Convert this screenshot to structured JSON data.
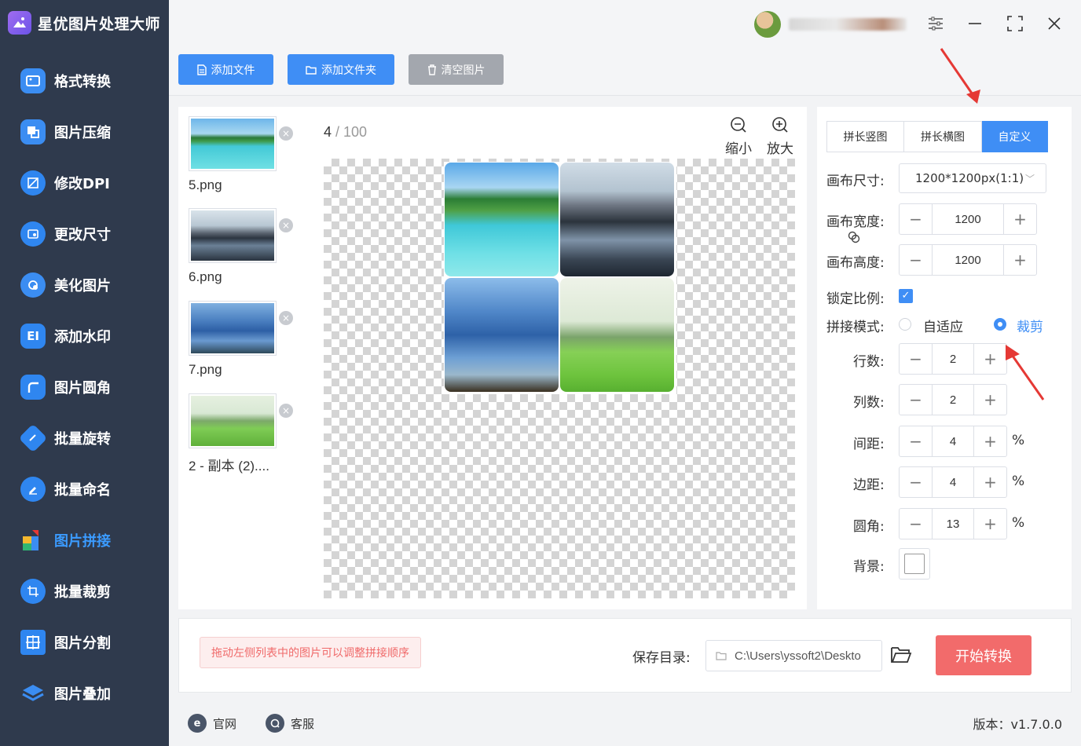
{
  "app": {
    "title": "星优图片处理大师"
  },
  "sidebar": {
    "items": [
      {
        "label": "格式转换",
        "icon": "image-convert-icon",
        "color": "#3b8df2"
      },
      {
        "label": "图片压缩",
        "icon": "image-compress-icon",
        "color": "#3b8df2"
      },
      {
        "label": "修改DPI",
        "icon": "dpi-icon",
        "color": "#2f86f0"
      },
      {
        "label": "更改尺寸",
        "icon": "resize-icon",
        "color": "#2f86f0"
      },
      {
        "label": "美化图片",
        "icon": "beautify-icon",
        "color": "#3b8df2"
      },
      {
        "label": "添加水印",
        "icon": "watermark-icon",
        "color": "#2f86f0"
      },
      {
        "label": "图片圆角",
        "icon": "rounded-corner-icon",
        "color": "#2f86f0"
      },
      {
        "label": "批量旋转",
        "icon": "rotate-icon",
        "color": "#2f86f0"
      },
      {
        "label": "批量命名",
        "icon": "rename-icon",
        "color": "#2f86f0"
      },
      {
        "label": "图片拼接",
        "icon": "stitch-icon",
        "color": "#3b9bff",
        "active": true
      },
      {
        "label": "批量裁剪",
        "icon": "crop-icon",
        "color": "#2f86f0"
      },
      {
        "label": "图片分割",
        "icon": "split-icon",
        "color": "#2f86f0"
      },
      {
        "label": "图片叠加",
        "icon": "layers-icon",
        "color": "#2f86f0"
      }
    ]
  },
  "toolbar": {
    "add_file": "添加文件",
    "add_folder": "添加文件夹",
    "clear": "清空图片"
  },
  "file_list": [
    {
      "name": "5.png"
    },
    {
      "name": "6.png"
    },
    {
      "name": "7.png"
    },
    {
      "name": "2 - 副本 (2)...."
    }
  ],
  "preview": {
    "current": "4",
    "total": "/ 100",
    "zoom_out": "缩小",
    "zoom_in": "放大"
  },
  "settings": {
    "modes": [
      "拼长竖图",
      "拼长横图",
      "自定义"
    ],
    "canvas_size_label": "画布尺寸:",
    "canvas_size_value": "1200*1200px(1:1)",
    "canvas_width_label": "画布宽度:",
    "canvas_width": "1200",
    "canvas_height_label": "画布高度:",
    "canvas_height": "1200",
    "lock_ratio_label": "锁定比例:",
    "stitch_mode_label": "拼接模式:",
    "stitch_mode_fit": "自适应",
    "stitch_mode_crop": "裁剪",
    "rows_label": "行数:",
    "rows": "2",
    "cols_label": "列数:",
    "cols": "2",
    "spacing_label": "间距:",
    "spacing": "4",
    "margin_label": "边距:",
    "margin": "4",
    "radius_label": "圆角:",
    "radius": "13",
    "percent": "%",
    "background_label": "背景:"
  },
  "action": {
    "hint": "拖动左侧列表中的图片可以调整拼接顺序",
    "save_label": "保存目录:",
    "save_path": "C:\\Users\\yssoft2\\Deskto",
    "start": "开始转换"
  },
  "footer": {
    "website": "官网",
    "support": "客服",
    "version": "版本：v1.7.0.0"
  },
  "colors": {
    "accent": "#3f8ef5",
    "sidebar_bg": "#2f3a4d",
    "start_button": "#f26b6b",
    "annotation_arrow": "#e53935"
  }
}
